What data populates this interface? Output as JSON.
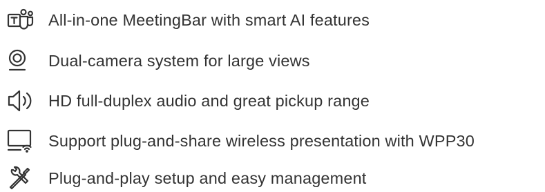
{
  "features": [
    {
      "icon": "teams-icon",
      "label": "All-in-one MeetingBar with smart AI features"
    },
    {
      "icon": "webcam-icon",
      "label": "Dual-camera system for large views"
    },
    {
      "icon": "speaker-icon",
      "label": "HD full-duplex audio and great pickup range"
    },
    {
      "icon": "wireless-presentation-icon",
      "label": "Support plug-and-share wireless presentation with WPP30"
    },
    {
      "icon": "tools-icon",
      "label": "Plug-and-play setup and easy management"
    }
  ],
  "colors": {
    "text": "#333333",
    "icon_stroke": "#333333",
    "background": "#ffffff"
  }
}
